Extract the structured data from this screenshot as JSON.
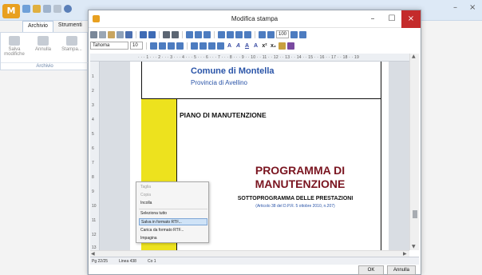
{
  "background_app": {
    "logo_text": "M",
    "tabs": [
      "Archivio",
      "Strumenti"
    ],
    "ribbon_buttons": [
      "Salva modifiche",
      "Annulla",
      "Stampa..."
    ],
    "ribbon_group": "Archivio",
    "window_controls": [
      "–",
      "×"
    ]
  },
  "dialog": {
    "title": "Modifica stampa",
    "controls": {
      "minimize": "–",
      "maximize": "☐",
      "close": "×"
    },
    "font_name": "Tahoma",
    "font_size": "10",
    "zoom_value": "100",
    "format_buttons": [
      "A",
      "A",
      "A",
      "A",
      "x²",
      "x₂"
    ],
    "ruler_marks": "· · · 1 · · · 2 · · · 3 · · · 4 · · · 5 · · · 6 · · · 7 · · · 8 · · · 9 · · 10 · · 11 · · 12 · · 13 · · 14 · · 15 · · 16 · · 17 · · 18 · · 19",
    "vertical_ruler": [
      "1",
      "2",
      "3",
      "4",
      "5",
      "6",
      "7",
      "8",
      "9",
      "10",
      "11",
      "12",
      "13"
    ],
    "document": {
      "comune": "Comune di Montella",
      "provincia": "Provincia di Avellino",
      "piano": "PIANO DI MANUTENZIONE",
      "programma_line1": "PROGRAMMA DI",
      "programma_line2": "MANUTENZIONE",
      "sottoprogramma": "SOTTOPROGRAMMA DELLE PRESTAZIONI",
      "articolo": "(Articolo 38 del D.P.R. 5 ottobre 2010, n.207)"
    },
    "context_menu": [
      {
        "label": "Taglia",
        "state": "disabled"
      },
      {
        "label": "Copia",
        "state": "disabled"
      },
      {
        "label": "Incolla",
        "state": "normal"
      },
      {
        "separator": true
      },
      {
        "label": "Seleziona tutto",
        "state": "normal"
      },
      {
        "label": "Salva in formato RTF...",
        "state": "highlight"
      },
      {
        "label": "Carica da formato RTF...",
        "state": "normal"
      },
      {
        "label": "Impagina",
        "state": "normal"
      }
    ],
    "status": {
      "page": "Pg 22/25",
      "line": "Linea 438",
      "col": "Co 1"
    },
    "ok_label": "OK",
    "cancel_label": "Annulla"
  }
}
